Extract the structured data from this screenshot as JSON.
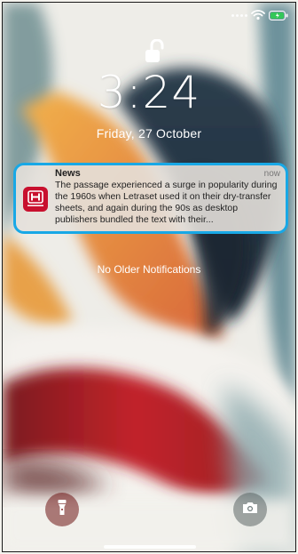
{
  "status": {
    "wifi_icon": "wifi-icon",
    "battery_icon": "battery-icon",
    "battery_color": "#34c759"
  },
  "lock": {
    "icon": "unlocked-padlock-icon"
  },
  "time": "3:24",
  "date": "Friday, 27 October",
  "notification": {
    "app": "News",
    "time": "now",
    "text": "The passage experienced a surge in popularity during the 1960s when Letraset used it on their dry-transfer sheets, and again during the 90s as desktop publishers bundled the text with their...",
    "icon": "honda-logo-icon",
    "highlight_color": "#18a8e6"
  },
  "no_older": "No Older Notifications",
  "quick_actions": {
    "left_icon": "flashlight-icon",
    "right_icon": "camera-icon"
  }
}
